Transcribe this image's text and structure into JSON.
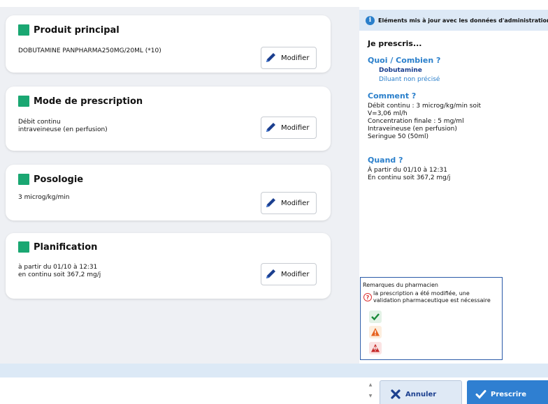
{
  "cards": [
    {
      "title": "Produit principal",
      "text": "DOBUTAMINE PANPHARMA250MG/20ML (*10)",
      "button": "Modifier"
    },
    {
      "title": "Mode de prescription",
      "text": "Débit continu\nintraveineuse (en perfusion)",
      "button": "Modifier"
    },
    {
      "title": "Posologie",
      "text": "3 microg/kg/min",
      "button": "Modifier"
    },
    {
      "title": "Planification",
      "text": "à partir du 01/10 à 12:31\nen continu soit 367,2 mg/j",
      "button": "Modifier"
    }
  ],
  "summary": {
    "banner": "Eléments mis à jour avec les données d'administration",
    "heading": "Je prescris...",
    "quoi_title": "Quoi / Combien ?",
    "drug": "Dobutamine",
    "diluant": "Diluant non précisé",
    "comment_title": "Comment ?",
    "comment_text": "Débit continu : 3 microg/kg/min soit\nV=3,06 ml/h\nConcentration finale : 5 mg/ml\nIntraveineuse (en perfusion)\nSeringue 50 (50ml)",
    "quand_title": "Quand ?",
    "quand_text": "À partir du 01/10 à 12:31\nEn continu soit 367,2 mg/j"
  },
  "pharmacist": {
    "title": "Remarques du pharmacien",
    "message": "la prescription a été modifiée, une\nvalidation pharmaceutique est nécessaire"
  },
  "footer": {
    "cancel_label": "Annuler",
    "prescribe_label": "Prescrire"
  },
  "colors": {
    "accent": "#2a7fcb",
    "card_marker": "#1aa772",
    "primary_button": "#2f7fd1"
  },
  "icons": [
    "info-icon",
    "pencil-icon",
    "question-circle-icon",
    "check-icon",
    "warning-icon",
    "danger-icon",
    "close-x-icon",
    "checkmark-icon"
  ]
}
